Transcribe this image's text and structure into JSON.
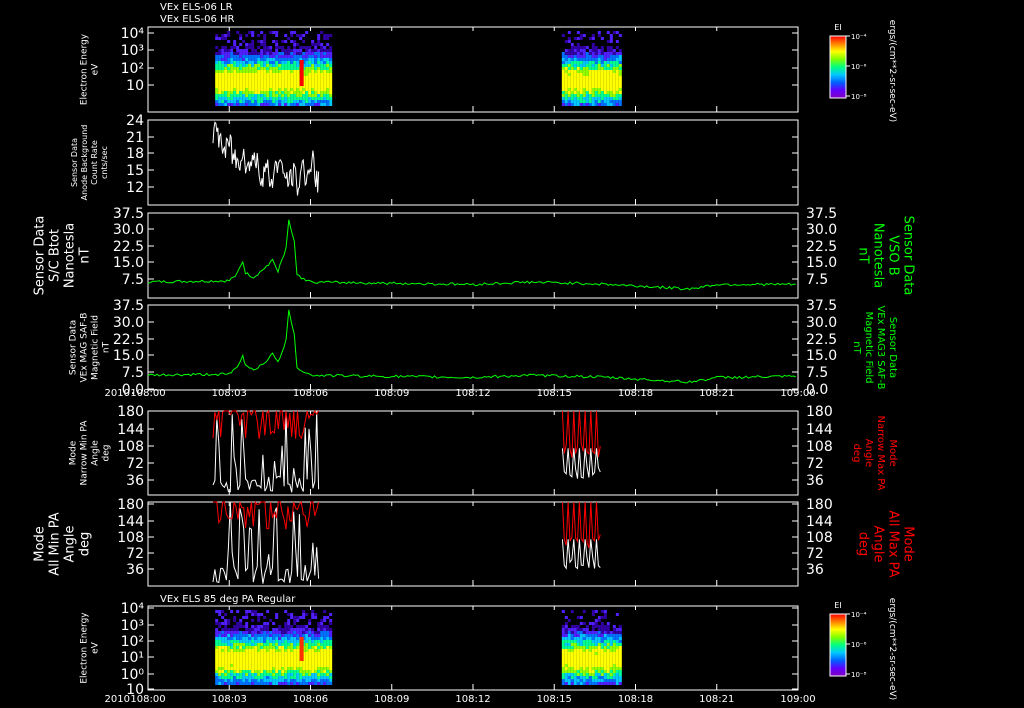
{
  "header": {
    "line1": "VEx ELS-06 LR",
    "line2": "VEx ELS-06 HR"
  },
  "panel7_title": "VEx ELS 85 deg PA Regular",
  "year_label": "2010",
  "time_ticks": [
    "108:00",
    "108:03",
    "108:06",
    "108:09",
    "108:12",
    "108:15",
    "108:18",
    "108:21",
    "109:00"
  ],
  "colors": {
    "white": "#ffffff",
    "green": "#00ff00",
    "red": "#ff0000"
  },
  "colorbar": {
    "title": "EI",
    "ticks": [
      "10⁻⁴",
      "10⁻⁶",
      "10⁻⁸"
    ],
    "unit": "ergs/(cm**2-sr-sec-eV)"
  },
  "chart_data": [
    {
      "type": "heatmap",
      "id": "p1",
      "ylabel": [
        "Electron Energy",
        "eV"
      ],
      "yticks": [
        "10⁴",
        "10³",
        "10²",
        "10"
      ],
      "segments": [
        {
          "start": "108:02.4",
          "end": "108:06.3"
        },
        {
          "start": "108:15.3",
          "end": "108:16.7"
        }
      ]
    },
    {
      "type": "line",
      "id": "p2",
      "ylabel": [
        "Sensor Data",
        "Anode Background",
        "Count Rate",
        "cnts/sec"
      ],
      "yticks": [
        "24",
        "21",
        "18",
        "15",
        "12"
      ],
      "ylim": [
        10,
        24
      ],
      "series": [
        {
          "x_start": 2.4,
          "x_end": 6.3,
          "values": [
            22,
            21,
            19,
            20,
            18,
            17,
            19,
            16,
            18,
            17,
            15,
            16,
            14,
            16,
            17,
            15,
            14,
            15,
            13,
            16,
            15,
            17,
            14,
            16
          ]
        }
      ]
    },
    {
      "type": "line",
      "id": "p3",
      "ylabel": [
        "Sensor Data",
        "S/C Btot",
        "Nanotesla",
        "nT"
      ],
      "ylabel_right": [
        "Sensor Data",
        "VSO B",
        "Nanotesla",
        "nT"
      ],
      "yticks": [
        "37.5",
        "30.0",
        "22.5",
        "15.0",
        "7.5"
      ],
      "ylim": [
        0,
        37.5
      ],
      "series": [
        {
          "points": [
            [
              0,
              7
            ],
            [
              3,
              7.5
            ],
            [
              3.3,
              11
            ],
            [
              3.5,
              16
            ],
            [
              3.6,
              11
            ],
            [
              3.9,
              9
            ],
            [
              4.3,
              13
            ],
            [
              4.6,
              17
            ],
            [
              4.8,
              12
            ],
            [
              5.1,
              22
            ],
            [
              5.2,
              35
            ],
            [
              5.4,
              25
            ],
            [
              5.5,
              10
            ],
            [
              6,
              7
            ],
            [
              9,
              6.5
            ],
            [
              12,
              6
            ],
            [
              14,
              7
            ],
            [
              16,
              6.5
            ],
            [
              17,
              6
            ],
            [
              20,
              4
            ],
            [
              21,
              6
            ],
            [
              24,
              6
            ]
          ]
        }
      ]
    },
    {
      "type": "line",
      "id": "p4",
      "ylabel": [
        "Sensor Data",
        "VEx MAG SAF-B",
        "Magnetic Field",
        "nT"
      ],
      "ylabel_right": [
        "Sensor Data",
        "VEx MAG3 SAF-B",
        "Magnetic Field",
        "nT"
      ],
      "yticks": [
        "37.5",
        "30.0",
        "22.5",
        "15.0",
        "7.5",
        "0.0"
      ],
      "ylim": [
        0,
        37.5
      ],
      "series": [
        {
          "points": [
            [
              0,
              6.5
            ],
            [
              3,
              7
            ],
            [
              3.3,
              10
            ],
            [
              3.5,
              15
            ],
            [
              3.6,
              11
            ],
            [
              3.9,
              9
            ],
            [
              4.3,
              12
            ],
            [
              4.6,
              16
            ],
            [
              4.8,
              12
            ],
            [
              5.1,
              22
            ],
            [
              5.2,
              35
            ],
            [
              5.4,
              25
            ],
            [
              5.5,
              10
            ],
            [
              6,
              6.5
            ],
            [
              9,
              6
            ],
            [
              12,
              5.5
            ],
            [
              14,
              6.5
            ],
            [
              16,
              6
            ],
            [
              17,
              5.5
            ],
            [
              20,
              3.5
            ],
            [
              21,
              5.5
            ],
            [
              24,
              6
            ]
          ]
        }
      ]
    },
    {
      "type": "line",
      "id": "p5",
      "ylabel": [
        "Mode",
        "Narrow Min PA",
        "Angle",
        "deg"
      ],
      "ylabel_right": [
        "Mode",
        "Narrow Max PA",
        "Angle",
        "deg"
      ],
      "yticks": [
        "180",
        "144",
        "108",
        "72",
        "36"
      ],
      "ylim": [
        0,
        180
      ],
      "series": [
        {
          "name": "Min",
          "color": "white",
          "segments": [
            {
              "start": 2.4,
              "end": 6.3
            },
            {
              "start": 15.3,
              "end": 16.7
            }
          ]
        },
        {
          "name": "Max",
          "color": "red",
          "segments": [
            {
              "start": 2.4,
              "end": 6.3
            },
            {
              "start": 15.3,
              "end": 16.7
            }
          ]
        }
      ]
    },
    {
      "type": "line",
      "id": "p6",
      "ylabel": [
        "Mode",
        "All Min PA",
        "Angle",
        "deg"
      ],
      "ylabel_right": [
        "Mode",
        "All Max PA",
        "Angle",
        "deg"
      ],
      "yticks": [
        "180",
        "144",
        "108",
        "72",
        "36"
      ],
      "ylim": [
        0,
        180
      ],
      "series": [
        {
          "name": "Min",
          "color": "white",
          "segments": [
            {
              "start": 2.4,
              "end": 6.3
            },
            {
              "start": 15.3,
              "end": 16.7
            }
          ]
        },
        {
          "name": "Max",
          "color": "red",
          "segments": [
            {
              "start": 2.4,
              "end": 6.3
            },
            {
              "start": 15.3,
              "end": 16.7
            }
          ]
        }
      ]
    },
    {
      "type": "heatmap",
      "id": "p7",
      "ylabel": [
        "Electron Energy",
        "eV"
      ],
      "yticks": [
        "10⁴",
        "10³",
        "10²",
        "10¹",
        "10⁰",
        "10"
      ],
      "segments": [
        {
          "start": "108:02.4",
          "end": "108:06.3"
        },
        {
          "start": "108:15.3",
          "end": "108:16.7"
        }
      ]
    }
  ]
}
